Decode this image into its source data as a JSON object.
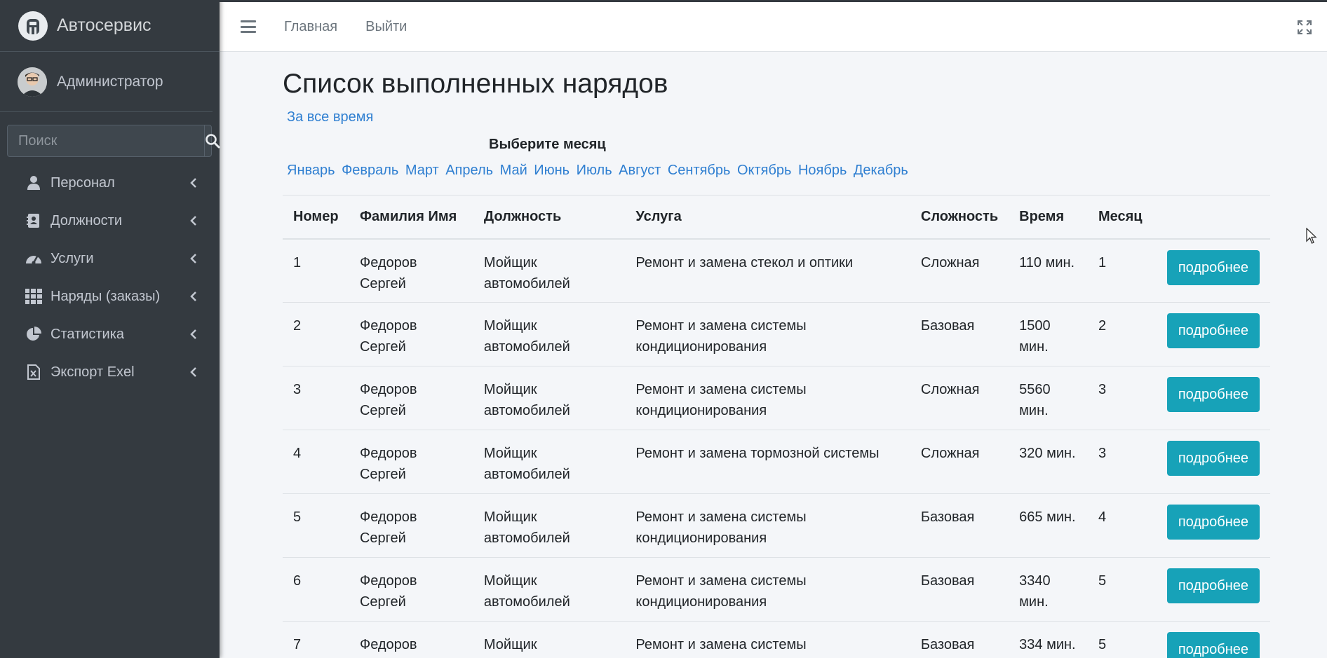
{
  "app": {
    "brand": "Автосервис",
    "user": "Администратор"
  },
  "search": {
    "placeholder": "Поиск"
  },
  "sidebar": {
    "items": [
      {
        "label": "Персонал",
        "icon": "user-icon"
      },
      {
        "label": "Должности",
        "icon": "address-book-icon"
      },
      {
        "label": "Услуги",
        "icon": "tachometer-icon"
      },
      {
        "label": "Наряды (заказы)",
        "icon": "grid-icon"
      },
      {
        "label": "Статистика",
        "icon": "pie-chart-icon"
      },
      {
        "label": "Экспорт Exel",
        "icon": "excel-file-icon"
      }
    ]
  },
  "header": {
    "home": "Главная",
    "logout": "Выйти"
  },
  "page": {
    "title": "Список выполненных нарядов",
    "all_time": "За все время",
    "month_title": "Выберите месяц",
    "months": [
      "Январь",
      "Февраль",
      "Март",
      "Апрель",
      "Май",
      "Июнь",
      "Июль",
      "Август",
      "Сентябрь",
      "Октябрь",
      "Ноябрь",
      "Декабрь"
    ]
  },
  "table": {
    "columns": [
      "Номер",
      "Фамилия Имя",
      "Должность",
      "Услуга",
      "Сложность",
      "Время",
      "Месяц"
    ],
    "button_label": "подробнее",
    "rows": [
      {
        "num": "1",
        "name": "Федоров Сергей",
        "position": "Мойщик автомобилей",
        "service": "Ремонт и замена стекол и оптики",
        "complexity": "Сложная",
        "time": "110 мин.",
        "month": "1"
      },
      {
        "num": "2",
        "name": "Федоров Сергей",
        "position": "Мойщик автомобилей",
        "service": "Ремонт и замена системы кондиционирования",
        "complexity": "Базовая",
        "time": "1500 мин.",
        "month": "2"
      },
      {
        "num": "3",
        "name": "Федоров Сергей",
        "position": "Мойщик автомобилей",
        "service": "Ремонт и замена системы кондиционирования",
        "complexity": "Сложная",
        "time": "5560 мин.",
        "month": "3"
      },
      {
        "num": "4",
        "name": "Федоров Сергей",
        "position": "Мойщик автомобилей",
        "service": "Ремонт и замена тормозной системы",
        "complexity": "Сложная",
        "time": "320 мин.",
        "month": "3"
      },
      {
        "num": "5",
        "name": "Федоров Сергей",
        "position": "Мойщик автомобилей",
        "service": "Ремонт и замена системы кондиционирования",
        "complexity": "Базовая",
        "time": "665 мин.",
        "month": "4"
      },
      {
        "num": "6",
        "name": "Федоров Сергей",
        "position": "Мойщик автомобилей",
        "service": "Ремонт и замена системы кондиционирования",
        "complexity": "Базовая",
        "time": "3340 мин.",
        "month": "5"
      },
      {
        "num": "7",
        "name": "Федоров Сергей",
        "position": "Мойщик автомобилей",
        "service": "Ремонт и замена системы",
        "complexity": "Базовая",
        "time": "334 мин.",
        "month": "5"
      }
    ]
  }
}
